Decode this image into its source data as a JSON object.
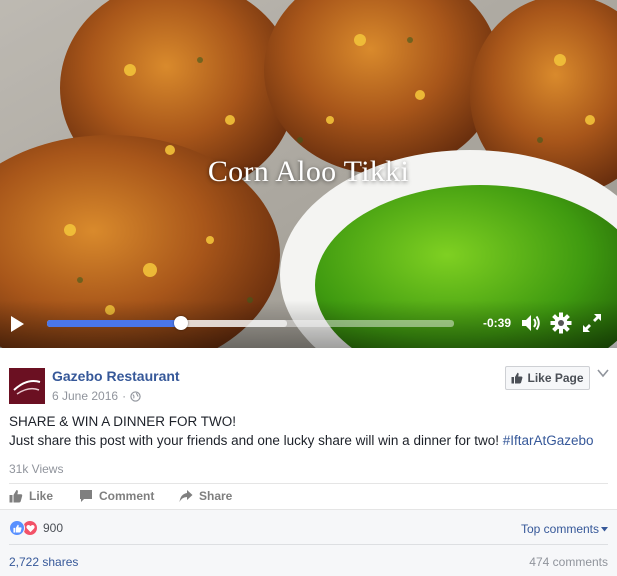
{
  "video": {
    "title": "Corn Aloo Tikki",
    "time_remaining": "-0:39",
    "progress": 0.33,
    "buffered": 0.59,
    "icons": [
      "play-icon",
      "volume-icon",
      "settings-icon",
      "fullscreen-icon"
    ]
  },
  "post": {
    "page_name": "Gazebo Restaurant",
    "date": "6 June 2016",
    "separator": "·",
    "like_page_label": "Like Page",
    "line1": "SHARE & WIN A DINNER FOR TWO!",
    "line2": "Just share this post with your friends and one lucky share will win a dinner for two!",
    "hashtag": "#IftarAtGazebo",
    "views": "31k Views"
  },
  "actions": {
    "like": "Like",
    "comment": "Comment",
    "share": "Share"
  },
  "footer": {
    "reaction_count": "900",
    "top_comments": "Top comments",
    "shares": "2,722 shares",
    "comments": "474 comments"
  },
  "colors": {
    "link": "#365899",
    "progress": "#4a76e8",
    "like_reaction": "#5890ff",
    "love_reaction": "#f25268",
    "avatar": "#6b1022"
  }
}
